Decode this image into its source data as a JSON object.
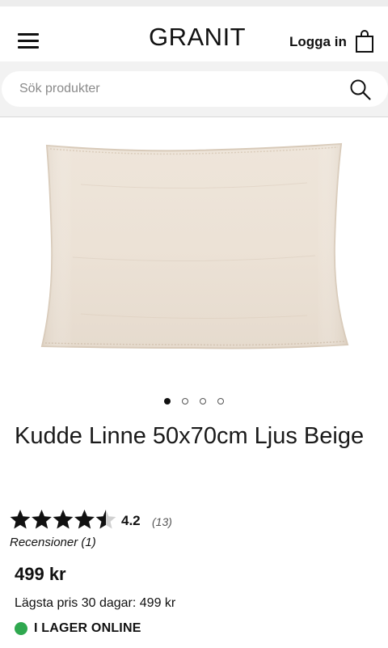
{
  "header": {
    "logo": "GRANIT",
    "login_label": "Logga in",
    "menu_icon": "hamburger-menu-icon",
    "cart_icon": "shopping-bag-icon"
  },
  "search": {
    "placeholder": "Sök produkter",
    "icon": "search-icon"
  },
  "gallery": {
    "image_alt": "Kudde Linne 50x70cm Ljus Beige",
    "image_count": 4,
    "active_index": 0
  },
  "product": {
    "title": "Kudde Linne 50x70cm Ljus Beige",
    "rating": {
      "stars": 4.5,
      "max_stars": 5,
      "value": "4.2",
      "count": "(13)"
    },
    "reviews_label": "Recensioner (1)",
    "price": "499 kr",
    "lowest_price_30_days": "Lägsta pris 30 dagar: 499 kr",
    "stock": {
      "label": "I LAGER ONLINE",
      "color": "#2fa84f"
    }
  }
}
